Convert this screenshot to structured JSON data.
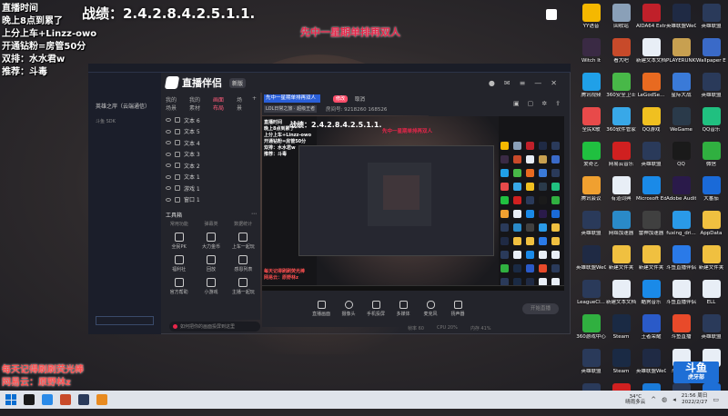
{
  "stream_overlay": {
    "left_lines": [
      "直播时间",
      "晚上8点到累了",
      "上分上车+Linzz-owo",
      "开通钻粉=房管50分",
      "双排：水水君w",
      "推荐：斗毒"
    ],
    "stats": "战绩：2.4.2.8.4.2.5.1.1.",
    "banner": "先中一星期单排再双人",
    "bottom_left": [
      "每天记得刷刷荧光棒",
      "网易云：原野林z"
    ]
  },
  "desktop_icons": [
    {
      "label": "YY语音",
      "color": "#f5b800"
    },
    {
      "label": "回收站",
      "color": "#8aa0b8"
    },
    {
      "label": "AIDA64 Extreme",
      "color": "#c0202a"
    },
    {
      "label": "英雄联盟WeGame版",
      "color": "#1f2a44"
    },
    {
      "label": "英雄联盟",
      "color": "#2a3a5a"
    },
    {
      "label": "Witch It",
      "color": "#3a2a44"
    },
    {
      "label": "看大吧",
      "color": "#c84a2a"
    },
    {
      "label": "新建文本文档",
      "color": "#e8eef6"
    },
    {
      "label": "PLAYERUNKNOWN'S BATTLEGROUNDS",
      "color": "#c8a050"
    },
    {
      "label": "Wallpaper Engine",
      "color": "#3a6ac8"
    },
    {
      "label": "腾讯视频",
      "color": "#20a0e8"
    },
    {
      "label": "360安全卫士",
      "color": "#48b848"
    },
    {
      "label": "LeGodSe...",
      "color": "#e86a20"
    },
    {
      "label": "星际大战",
      "color": "#3a7ad8"
    },
    {
      "label": "英雄联盟",
      "color": "#2a3a5a"
    },
    {
      "label": "全民K歌",
      "color": "#e84a4a"
    },
    {
      "label": "360软件管家",
      "color": "#38a8e8"
    },
    {
      "label": "QQ游戏",
      "color": "#f0c020"
    },
    {
      "label": "WeGame",
      "color": "#2a3a4a"
    },
    {
      "label": "QQ音乐",
      "color": "#20c080"
    },
    {
      "label": "爱奇艺",
      "color": "#20c040"
    },
    {
      "label": "网易云音乐",
      "color": "#d02020"
    },
    {
      "label": "英雄联盟",
      "color": "#2a3a5a"
    },
    {
      "label": "QQ",
      "color": "#1a1a1a"
    },
    {
      "label": "微信",
      "color": "#30b040"
    },
    {
      "label": "腾讯会议",
      "color": "#f0a030"
    },
    {
      "label": "有道词典",
      "color": "#e8eef6"
    },
    {
      "label": "Microsoft Edge",
      "color": "#1a8ae8"
    },
    {
      "label": "Adobe Audition",
      "color": "#2a1a4a"
    },
    {
      "label": "大番茄",
      "color": "#1a6ad8"
    },
    {
      "label": "英雄联盟",
      "color": "#2a3a5a"
    },
    {
      "label": "网络加速器",
      "color": "#2a8ac8"
    },
    {
      "label": "雷神加速器",
      "color": "#404040"
    },
    {
      "label": "fuxing_dri...",
      "color": "#2a9ae8"
    },
    {
      "label": "AppData",
      "color": "#f0c040"
    },
    {
      "label": "英雄联盟WeGame版",
      "color": "#1f2a44"
    },
    {
      "label": "新建文件夹",
      "color": "#f0c040"
    },
    {
      "label": "新建文件夹",
      "color": "#f0c040"
    },
    {
      "label": "斗鱼直播伴侣",
      "color": "#2a7ae8"
    },
    {
      "label": "新建文件夹",
      "color": "#f0c040"
    },
    {
      "label": "LeagueCl...",
      "color": "#2a3a5a"
    },
    {
      "label": "新建文本文档",
      "color": "#e8eef6"
    },
    {
      "label": "酷狗音乐",
      "color": "#1a8ae8"
    },
    {
      "label": "斗鱼直播伴侣",
      "color": "#e8eef6"
    },
    {
      "label": "ELL",
      "color": "#e8eef6"
    },
    {
      "label": "360游戏中心",
      "color": "#30b040"
    },
    {
      "label": "Steam",
      "color": "#1a2a44"
    },
    {
      "label": "王者荣耀",
      "color": "#2a5ac8"
    },
    {
      "label": "斗鱼直播",
      "color": "#e84a2a"
    },
    {
      "label": "英雄联盟",
      "color": "#2a3a5a"
    },
    {
      "label": "英雄联盟",
      "color": "#2a3a5a"
    },
    {
      "label": "Steam",
      "color": "#1a2a44"
    },
    {
      "label": "英雄联盟WeGame版",
      "color": "#1f2a44"
    },
    {
      "label": "斗鱼直播",
      "color": "#e8eef6"
    },
    {
      "label": "LOL",
      "color": "#e8eef6"
    },
    {
      "label": "LeagueCl...",
      "color": "#2a3a5a"
    },
    {
      "label": "网易云音乐",
      "color": "#d02020"
    },
    {
      "label": "360压缩",
      "color": "#1a7ad8"
    },
    {
      "label": "LeLeague",
      "color": "#2a3a5a"
    },
    {
      "label": "斗鱼",
      "color": "#1e6fd6"
    }
  ],
  "app": {
    "name": "直播伴侣",
    "version": "新版",
    "panel_tabs": [
      "我的场景",
      "我的素材",
      "画面布局",
      "场景"
    ],
    "layers": [
      "文本 6",
      "文本 5",
      "文本 4",
      "文本 3",
      "文本 2",
      "文本 1",
      "游戏 1",
      "窗口 1"
    ],
    "tools_title": "工具箱",
    "tool_subtabs": [
      "常用功能",
      "弹幕类",
      "数据统计"
    ],
    "tools": [
      "全民PK",
      "大力金币",
      "上车一起玩",
      "福利社",
      "回放",
      "感恩列表",
      "官方帮助",
      "小游戏",
      "主播一起玩"
    ],
    "feedback": "如何把你的画面投屏到这里",
    "room_title": "先中一星期单排再双人",
    "edit_label": "修改",
    "cancel_label": "取消",
    "category": "LOL日常之旅 · 超级王者",
    "room_info": "房间号: 9218260    168526",
    "bottom_tools": [
      "直播画面",
      "摄像头",
      "手机投屏",
      "多媒体",
      "麦克风",
      "扬声器"
    ],
    "start_live": "开始直播",
    "status": [
      "帧率 60",
      "CPU 20%",
      "内存 41%"
    ]
  },
  "game_client": {
    "title": "英雄之岸（云端通信）",
    "sub": "斗鱼 SDK"
  },
  "preview": {
    "stats": "战绩：2.4.2.8.4.2.5.1.1.",
    "banner": "先中一星期单排再双人",
    "left_lines": [
      "直播时间",
      "晚上8点到累了",
      "上分上车+Linzz-owo",
      "开通钻粉=房管50分",
      "双排：水水君w",
      "推荐：斗毒"
    ],
    "bottom_lines": [
      "每天记得刷刷荧光棒",
      "网易云：原野林z"
    ]
  },
  "taskbar": {
    "icon_colors": [
      "#1a1a1a",
      "#2a8ae8",
      "#c84a2a",
      "#2a3a5a",
      "#e88a20"
    ],
    "weather_temp": "34°C",
    "weather_desc": "晴雨多云",
    "time": "21:56 周日",
    "date": "2022/2/27"
  },
  "watermark": {
    "brand": "斗鱼",
    "sub": "虎牙部"
  },
  "colors": {
    "accent_red": "#e8264a",
    "room_input": "#2a5fd8",
    "desktop_bg": "#2e2a2c"
  }
}
